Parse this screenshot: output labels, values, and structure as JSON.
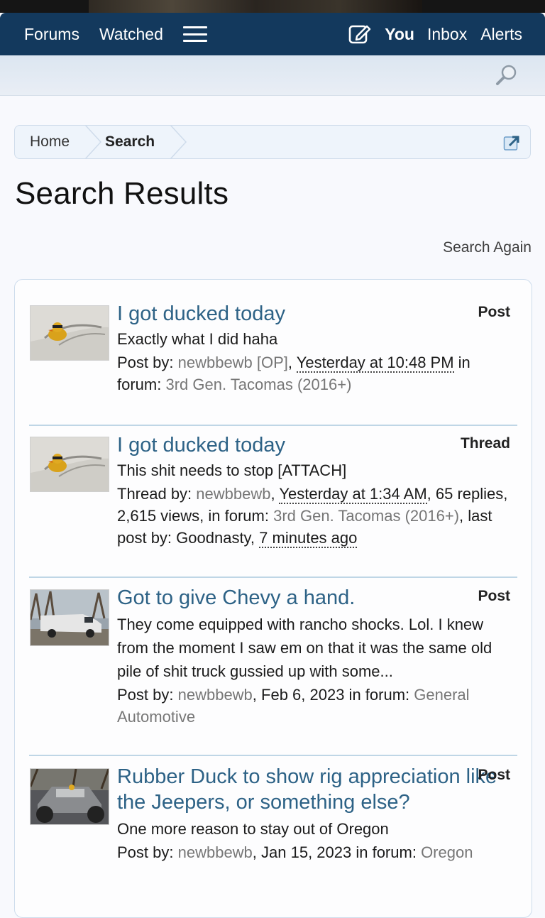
{
  "nav": {
    "forums": "Forums",
    "watched": "Watched",
    "you": "You",
    "inbox": "Inbox",
    "alerts": "Alerts"
  },
  "breadcrumb": {
    "home": "Home",
    "search": "Search"
  },
  "page": {
    "title": "Search Results",
    "search_again": "Search Again"
  },
  "results": [
    {
      "title": "I got ducked today",
      "type": "Post",
      "snippet": "Exactly what I did haha",
      "meta": {
        "by_label": "Post by:",
        "author": "newbbewb [OP]",
        "sep1": ",",
        "date": "Yesterday at 10:48 PM",
        "in_forum": "in forum:",
        "forum": "3rd Gen. Tacomas (2016+)"
      }
    },
    {
      "title": "I got ducked today",
      "type": "Thread",
      "snippet": "This shit needs to stop [ATTACH]",
      "meta": {
        "by_label": "Thread by:",
        "author": "newbbewb",
        "sep1": ",",
        "date": "Yesterday at 1:34 AM",
        "stats": ", 65 replies, 2,615 views, in forum:",
        "forum": "3rd Gen. Tacomas (2016+)",
        "last_post": ", last post by: Goodnasty,",
        "last_time": "7 minutes ago"
      }
    },
    {
      "title": "Got to give Chevy a hand.",
      "type": "Post",
      "snippet": "They come equipped with rancho shocks. Lol. I knew from the moment I saw em on that it was the same old pile of shit truck gussied up with some...",
      "meta": {
        "by_label": "Post by:",
        "author": "newbbewb",
        "date_plain": ", Feb 6, 2023 in forum:",
        "forum": "General Automotive"
      }
    },
    {
      "title": "Rubber Duck to show rig appreciation like the Jeepers, or something else?",
      "type": "Post",
      "snippet": "One more reason to stay out of Oregon",
      "meta": {
        "by_label": "Post by:",
        "author": "newbbewb",
        "date_plain": ", Jan 15, 2023 in forum:",
        "forum": "Oregon"
      }
    }
  ]
}
